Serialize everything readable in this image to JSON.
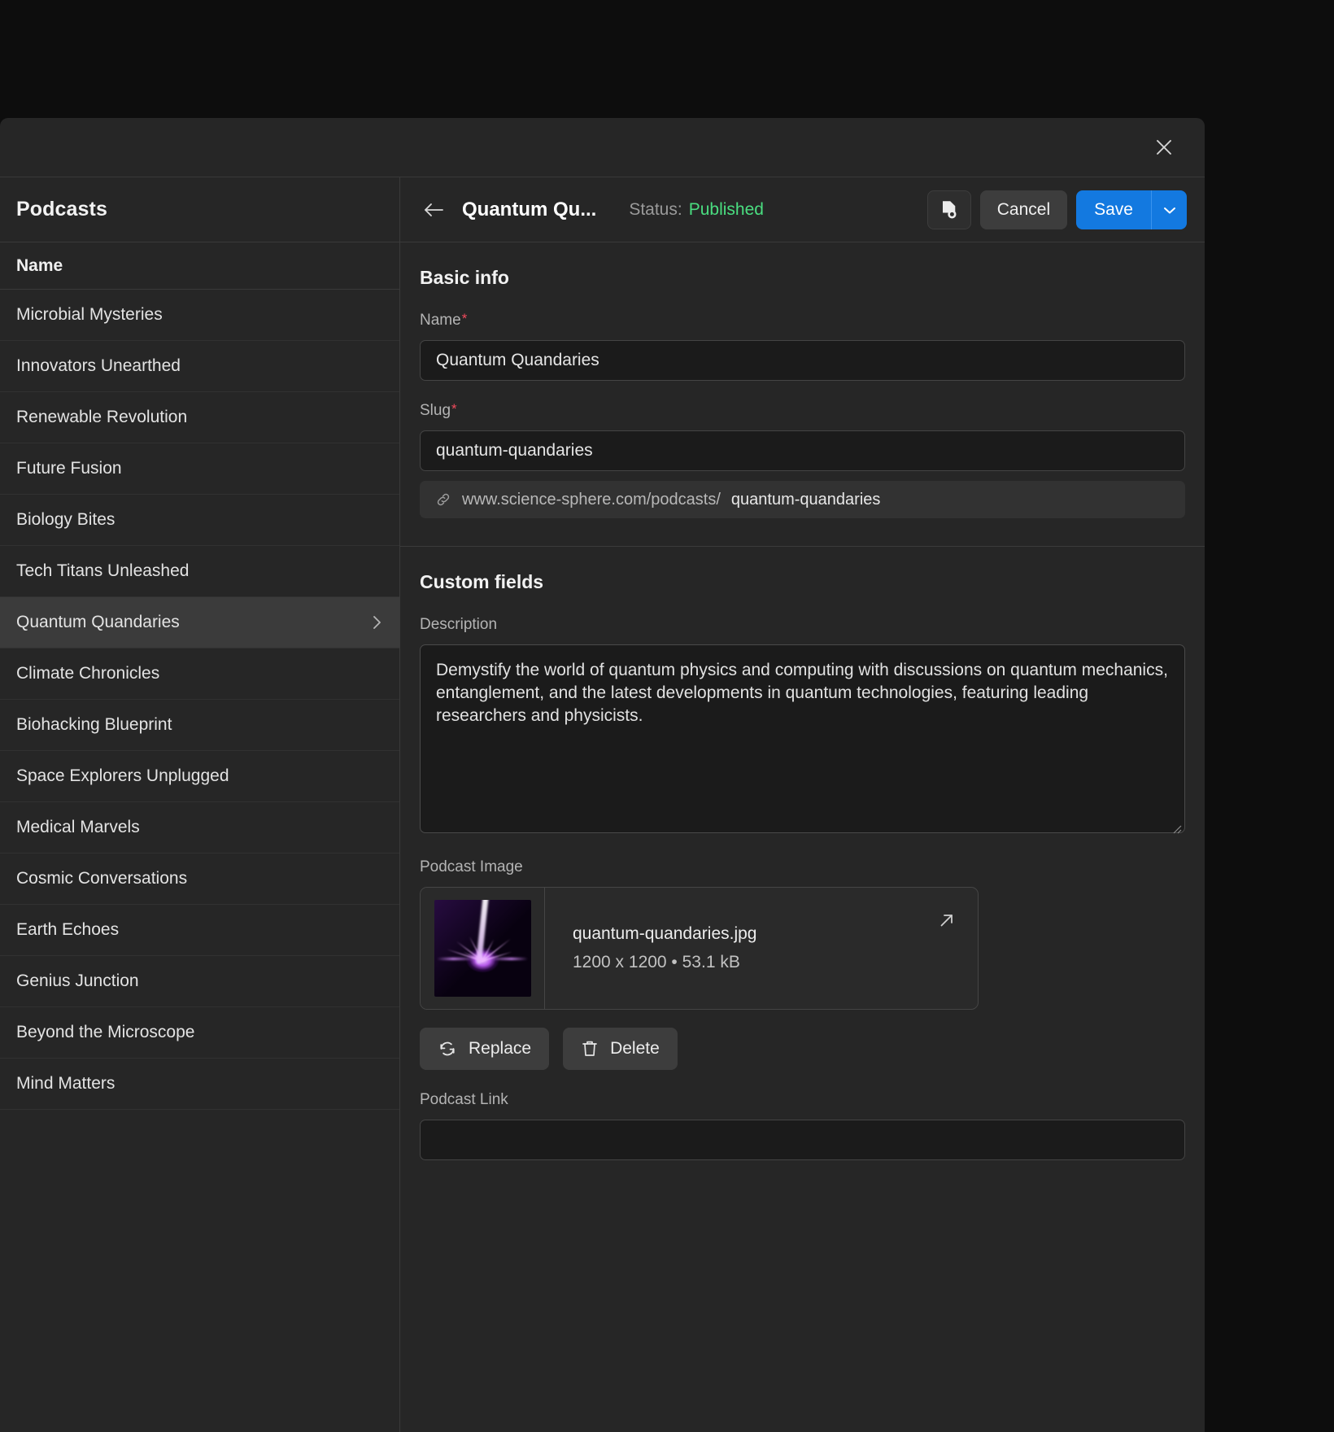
{
  "window": {
    "close_label": "×"
  },
  "sidebar": {
    "title": "Podcasts",
    "column_header": "Name",
    "items": [
      {
        "label": "Microbial Mysteries",
        "selected": false
      },
      {
        "label": "Innovators Unearthed",
        "selected": false
      },
      {
        "label": "Renewable Revolution",
        "selected": false
      },
      {
        "label": "Future Fusion",
        "selected": false
      },
      {
        "label": "Biology Bites",
        "selected": false
      },
      {
        "label": "Tech Titans Unleashed",
        "selected": false
      },
      {
        "label": "Quantum Quandaries",
        "selected": true
      },
      {
        "label": "Climate Chronicles",
        "selected": false
      },
      {
        "label": "Biohacking Blueprint",
        "selected": false
      },
      {
        "label": "Space Explorers Unplugged",
        "selected": false
      },
      {
        "label": "Medical Marvels",
        "selected": false
      },
      {
        "label": "Cosmic Conversations",
        "selected": false
      },
      {
        "label": "Earth Echoes",
        "selected": false
      },
      {
        "label": "Genius Junction",
        "selected": false
      },
      {
        "label": "Beyond the Microscope",
        "selected": false
      },
      {
        "label": "Mind Matters",
        "selected": false
      }
    ]
  },
  "detail": {
    "title": "Quantum Qu...",
    "status_label": "Status:",
    "status_value": "Published",
    "status_color": "#4ade80",
    "preview_icon": "document-preview-icon",
    "cancel_label": "Cancel",
    "save_label": "Save",
    "save_caret_icon": "chevron-down-icon",
    "back_icon": "arrow-left-icon"
  },
  "basic_info": {
    "section_title": "Basic info",
    "name": {
      "label": "Name",
      "required_marker": "*",
      "value": "Quantum Quandaries",
      "placeholder": ""
    },
    "slug": {
      "label": "Slug",
      "required_marker": "*",
      "value": "quantum-quandaries",
      "placeholder": "",
      "url_base": "www.science-sphere.com/podcasts/",
      "url_slug": "quantum-quandaries"
    }
  },
  "custom_fields": {
    "section_title": "Custom fields",
    "description": {
      "label": "Description",
      "value": "Demystify the world of quantum physics and computing with discussions on quantum mechanics, entanglement, and the latest developments in quantum technologies, featuring leading researchers and physicists.",
      "placeholder": ""
    },
    "podcast_image": {
      "label": "Podcast Image",
      "file_name": "quantum-quandaries.jpg",
      "file_meta": "1200 x 1200 • 53.1 kB",
      "replace_label": "Replace",
      "delete_label": "Delete",
      "open_icon": "external-link-icon"
    },
    "podcast_link": {
      "label": "Podcast Link",
      "value": "",
      "placeholder": ""
    }
  },
  "colors": {
    "accent": "#1379e0",
    "panel": "#262626",
    "input": "#1b1b1b",
    "required": "#ef4a5b"
  }
}
